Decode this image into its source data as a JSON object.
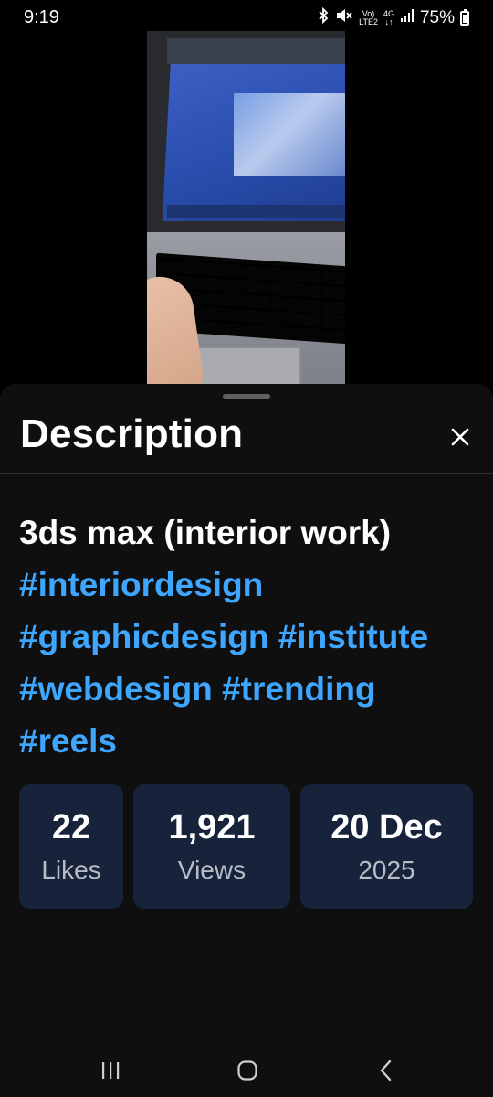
{
  "status_bar": {
    "time": "9:19",
    "battery_text": "75%",
    "network_icon_text_top": "Vo)",
    "network_icon_text_bottom": "LTE2",
    "network_gen": "4G",
    "icons": [
      "bluetooth-icon",
      "mute-icon",
      "volte-icon",
      "4g-icon",
      "signal-icon",
      "battery-icon"
    ]
  },
  "video": {
    "icon": "video-thumbnail"
  },
  "sheet": {
    "title": "Description",
    "close_icon": "close-icon",
    "description_text": "3ds max (interior work) ",
    "hashtags": [
      "#interiordesign",
      "#graphicdesign",
      "#institute",
      "#webdesign",
      "#trending",
      "#reels"
    ],
    "stats": [
      {
        "value": "22",
        "label": "Likes"
      },
      {
        "value": "1,921",
        "label": "Views"
      },
      {
        "value": "20 Dec",
        "label": "2025"
      }
    ]
  },
  "navbar": {
    "icons": [
      "recents-icon",
      "home-icon",
      "back-icon"
    ]
  },
  "colors": {
    "background": "#000000",
    "sheet_bg": "#0f0f0f",
    "hashtag": "#3ea6ff",
    "stat_card_bg": "#17233a"
  }
}
